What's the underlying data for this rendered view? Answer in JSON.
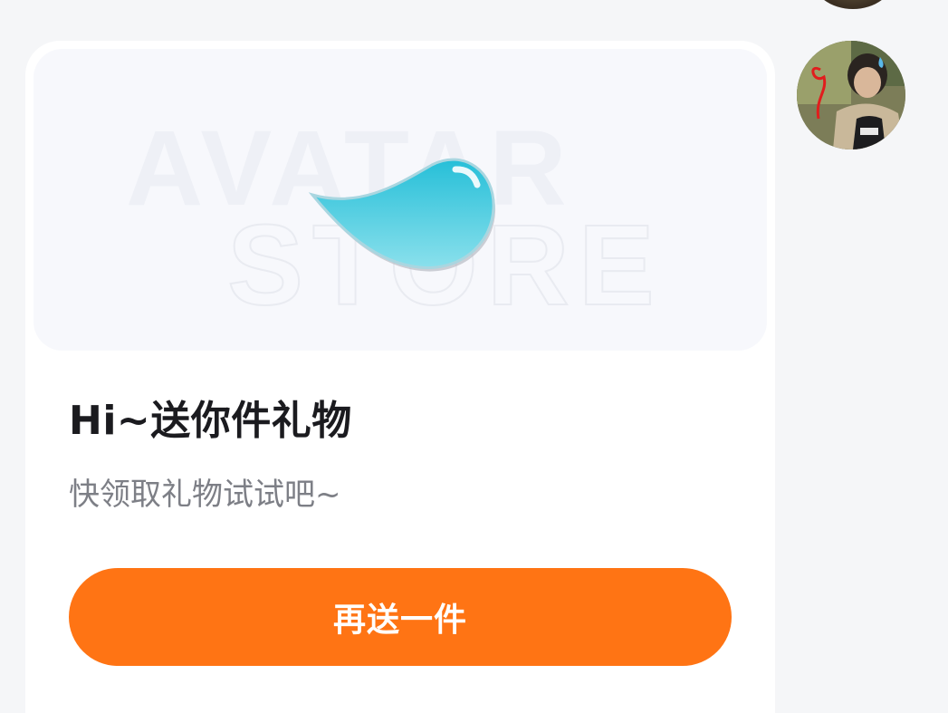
{
  "banner": {
    "watermark_line1": "AVATAR",
    "watermark_line2": "STORE",
    "gift_icon": "water-droplet-icon"
  },
  "gift_card": {
    "title": "Hi~送你件礼物",
    "subtitle": "快领取礼物试试吧~",
    "button_label": "再送一件"
  },
  "colors": {
    "accent": "#ff7414",
    "droplet": "#3cc8dc",
    "title_text": "#1b1b1f",
    "subtitle_text": "#7d7f86"
  }
}
